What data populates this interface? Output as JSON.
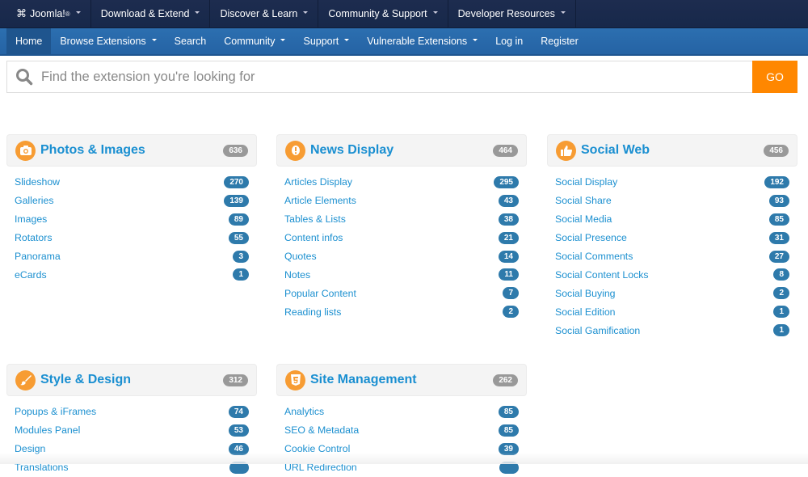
{
  "topbar": {
    "items": [
      {
        "label": "Joomla!",
        "sup": "®",
        "icon": "joomla-logo-icon"
      },
      {
        "label": "Download & Extend"
      },
      {
        "label": "Discover & Learn"
      },
      {
        "label": "Community & Support"
      },
      {
        "label": "Developer Resources"
      }
    ]
  },
  "navbar": {
    "items": [
      {
        "label": "Home",
        "active": true
      },
      {
        "label": "Browse Extensions",
        "dropdown": true
      },
      {
        "label": "Search"
      },
      {
        "label": "Community",
        "dropdown": true
      },
      {
        "label": "Support",
        "dropdown": true
      },
      {
        "label": "Vulnerable Extensions",
        "dropdown": true
      },
      {
        "label": "Log in"
      },
      {
        "label": "Register"
      }
    ]
  },
  "search": {
    "placeholder": "Find the extension you're looking for",
    "value": "",
    "button": "GO"
  },
  "colors": {
    "accent_orange": "#ff8700",
    "icon_orange": "#f79c33",
    "link_blue": "#1c90d0",
    "badge_blue": "#2e7aab",
    "nav_blue": "#2c6fb0",
    "topbar_navy": "#1d2c4f"
  },
  "categories": [
    {
      "title": "Photos & Images",
      "icon": "camera-icon",
      "total": "636",
      "items": [
        {
          "label": "Slideshow",
          "count": "270"
        },
        {
          "label": "Galleries",
          "count": "139"
        },
        {
          "label": "Images",
          "count": "89"
        },
        {
          "label": "Rotators",
          "count": "55"
        },
        {
          "label": "Panorama",
          "count": "3"
        },
        {
          "label": "eCards",
          "count": "1"
        }
      ]
    },
    {
      "title": "News Display",
      "icon": "exclamation-icon",
      "total": "464",
      "items": [
        {
          "label": "Articles Display",
          "count": "295"
        },
        {
          "label": "Article Elements",
          "count": "43"
        },
        {
          "label": "Tables & Lists",
          "count": "38"
        },
        {
          "label": "Content infos",
          "count": "21"
        },
        {
          "label": "Quotes",
          "count": "14"
        },
        {
          "label": "Notes",
          "count": "11"
        },
        {
          "label": "Popular Content",
          "count": "7"
        },
        {
          "label": "Reading lists",
          "count": "2"
        }
      ]
    },
    {
      "title": "Social Web",
      "icon": "thumbs-up-icon",
      "total": "456",
      "items": [
        {
          "label": "Social Display",
          "count": "192"
        },
        {
          "label": "Social Share",
          "count": "93"
        },
        {
          "label": "Social Media",
          "count": "85"
        },
        {
          "label": "Social Presence",
          "count": "31"
        },
        {
          "label": "Social Comments",
          "count": "27"
        },
        {
          "label": "Social Content Locks",
          "count": "8"
        },
        {
          "label": "Social Buying",
          "count": "2"
        },
        {
          "label": "Social Edition",
          "count": "1"
        },
        {
          "label": "Social Gamification",
          "count": "1"
        }
      ]
    },
    {
      "title": "Style & Design",
      "icon": "paintbrush-icon",
      "total": "312",
      "items": [
        {
          "label": "Popups & iFrames",
          "count": "74"
        },
        {
          "label": "Modules Panel",
          "count": "53"
        },
        {
          "label": "Design",
          "count": "46"
        },
        {
          "label": "Translations",
          "count": ""
        }
      ]
    },
    {
      "title": "Site Management",
      "icon": "html5-icon",
      "total": "262",
      "items": [
        {
          "label": "Analytics",
          "count": "85"
        },
        {
          "label": "SEO & Metadata",
          "count": "85"
        },
        {
          "label": "Cookie Control",
          "count": "39"
        },
        {
          "label": "URL Redirection",
          "count": ""
        }
      ]
    }
  ]
}
